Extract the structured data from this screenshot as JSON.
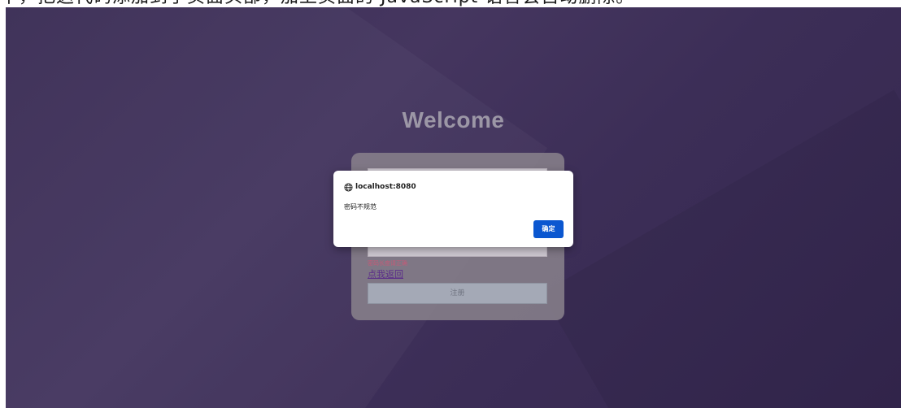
{
  "top_strip": {
    "text": "中，把这代码添加到子页面头部，加上页面的 JavaScript 语言会自动删除。"
  },
  "page": {
    "heading": "Welcome",
    "form": {
      "password_mask": "••••",
      "error_text": "密码长度请正确",
      "back_link": "点我返回",
      "register_button": "注册"
    }
  },
  "dialog": {
    "origin": "localhost:8080",
    "message": "密码不规范",
    "ok_label": "确定",
    "icon": "globe-icon",
    "accent_color": "#0b57d0"
  }
}
